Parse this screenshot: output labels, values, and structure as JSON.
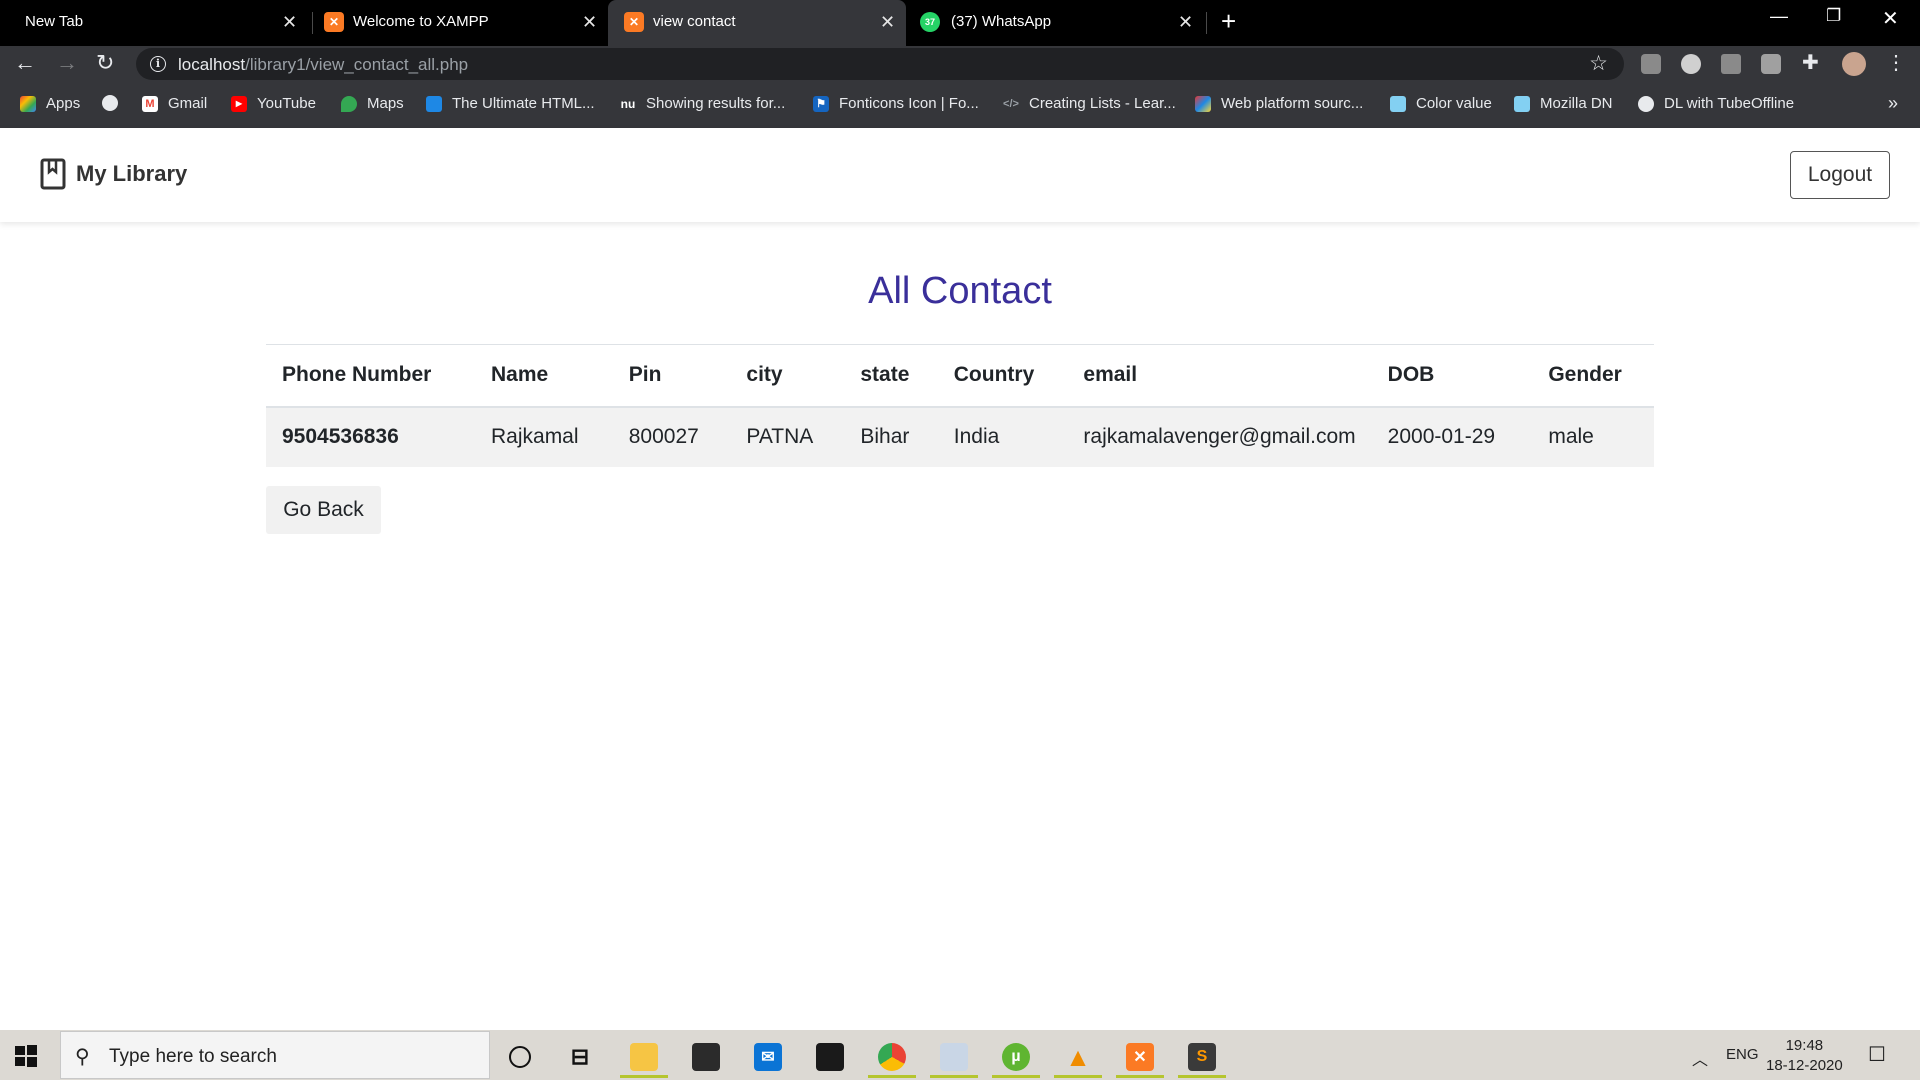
{
  "browser": {
    "tabs": [
      {
        "title": "New Tab",
        "favicon": "none"
      },
      {
        "title": "Welcome to XAMPP",
        "favicon": "xampp-icon"
      },
      {
        "title": "view contact",
        "favicon": "xampp-icon",
        "active": true
      },
      {
        "title": "(37) WhatsApp",
        "favicon": "whatsapp-icon",
        "badge": "37"
      }
    ],
    "url_host": "localhost",
    "url_path": "/library1/view_contact_all.php",
    "bookmarks": [
      {
        "label": "Apps",
        "icon": "apps-grid-icon"
      },
      {
        "label": "",
        "icon": "globe-icon"
      },
      {
        "label": "Gmail",
        "icon": "gmail-icon"
      },
      {
        "label": "YouTube",
        "icon": "youtube-icon"
      },
      {
        "label": "Maps",
        "icon": "maps-icon"
      },
      {
        "label": "The Ultimate HTML...",
        "icon": "shield-icon"
      },
      {
        "label": "Showing results for...",
        "icon": "nu-icon"
      },
      {
        "label": "Fonticons Icon | Fo...",
        "icon": "flag-icon"
      },
      {
        "label": "Creating Lists - Lear...",
        "icon": "code-icon"
      },
      {
        "label": "Web platform sourc...",
        "icon": "web-platform-icon"
      },
      {
        "label": "Color value",
        "icon": "mdn-icon"
      },
      {
        "label": "Mozilla DN",
        "icon": "mdn-icon"
      },
      {
        "label": "DL with TubeOffline",
        "icon": "globe-icon"
      }
    ]
  },
  "app": {
    "brand": "My Library",
    "logout_label": "Logout",
    "page_title": "All Contact",
    "table": {
      "headers": [
        "Phone Number",
        "Name",
        "Pin",
        "city",
        "state",
        "Country",
        "email",
        "DOB",
        "Gender"
      ],
      "rows": [
        [
          "9504536836",
          "Rajkamal",
          "800027",
          "PATNA",
          "Bihar",
          "India",
          "rajkamalavenger@gmail.com",
          "2000-01-29",
          "male"
        ]
      ]
    },
    "go_back_label": "Go Back"
  },
  "taskbar": {
    "search_placeholder": "Type here to search",
    "language": "ENG",
    "time": "19:48",
    "date": "18-12-2020"
  },
  "colors": {
    "title": "#3a2f9a",
    "row_bg": "#f2f2f2",
    "chrome_dark": "#35363a"
  }
}
